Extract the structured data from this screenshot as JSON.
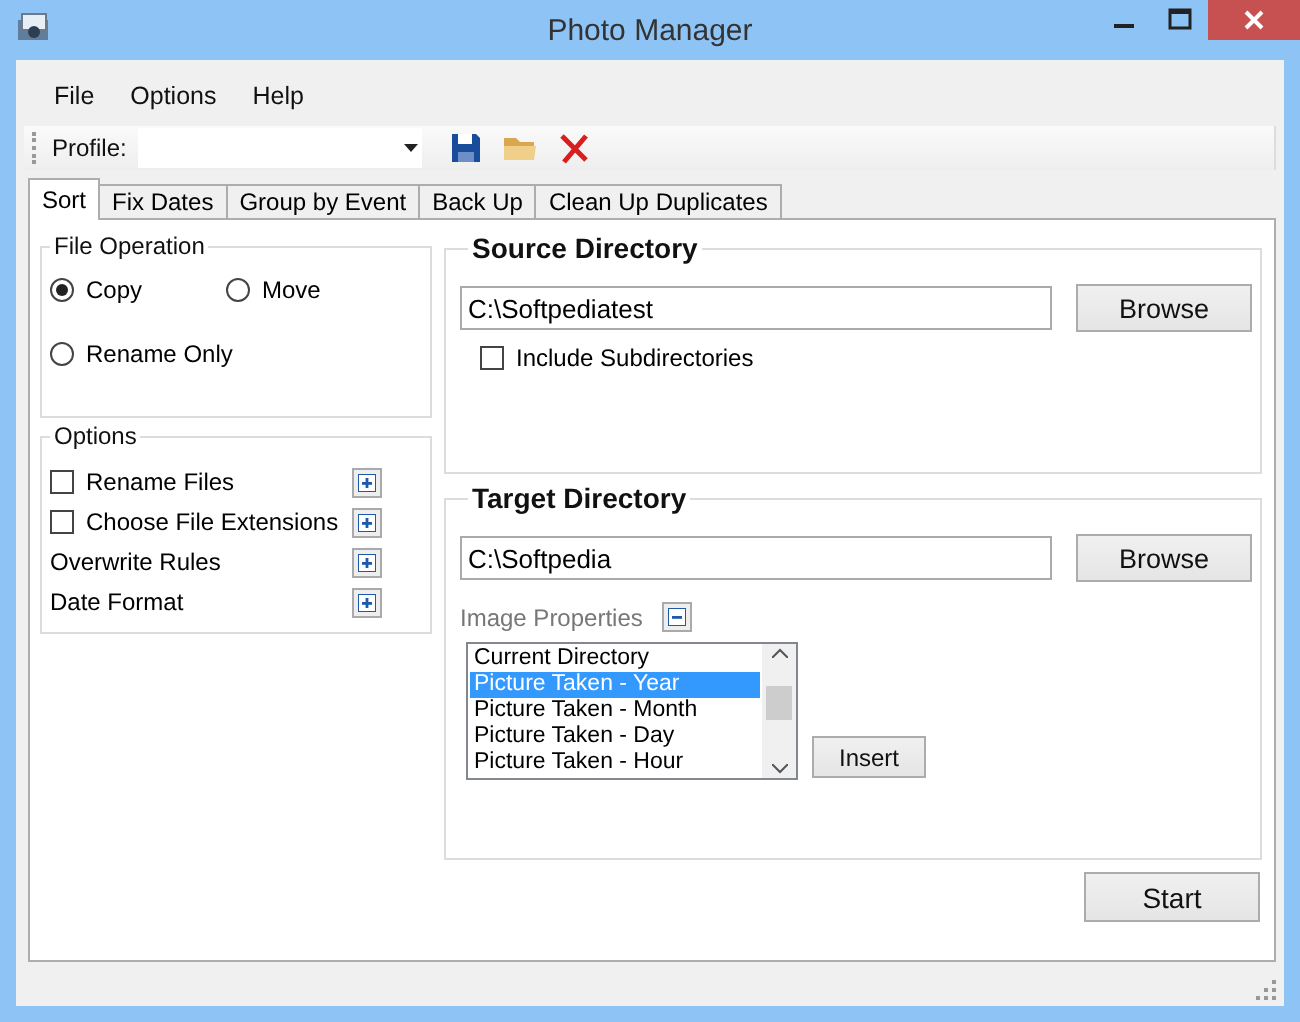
{
  "window": {
    "title": "Photo Manager"
  },
  "menu": [
    "File",
    "Options",
    "Help"
  ],
  "toolbar": {
    "profile_label": "Profile:"
  },
  "tabs": [
    {
      "label": "Sort",
      "selected": true
    },
    {
      "label": "Fix Dates",
      "selected": false
    },
    {
      "label": "Group by Event",
      "selected": false
    },
    {
      "label": "Back Up",
      "selected": false
    },
    {
      "label": "Clean Up Duplicates",
      "selected": false
    }
  ],
  "file_operation": {
    "title": "File Operation",
    "choices": [
      {
        "label": "Copy",
        "selected": true
      },
      {
        "label": "Move",
        "selected": false
      },
      {
        "label": "Rename Only",
        "selected": false
      }
    ]
  },
  "options": {
    "title": "Options",
    "items": [
      {
        "kind": "checkbox",
        "label": "Rename Files",
        "checked": false,
        "expanded": false
      },
      {
        "kind": "checkbox",
        "label": "Choose File Extensions",
        "checked": false,
        "expanded": false
      },
      {
        "kind": "plain",
        "label": "Overwrite Rules",
        "expanded": false
      },
      {
        "kind": "plain",
        "label": "Date Format",
        "expanded": false
      }
    ]
  },
  "source": {
    "title": "Source Directory",
    "path": "C:\\Softpediatest",
    "browse": "Browse",
    "include_subdirectories": {
      "label": "Include Subdirectories",
      "checked": false
    }
  },
  "target": {
    "title": "Target Directory",
    "path": "C:\\Softpedia",
    "browse": "Browse",
    "image_properties": {
      "label": "Image Properties",
      "expanded": true,
      "items": [
        {
          "label": "Current Directory",
          "selected": false
        },
        {
          "label": "Picture Taken - Year",
          "selected": true
        },
        {
          "label": "Picture Taken - Month",
          "selected": false
        },
        {
          "label": "Picture Taken - Day",
          "selected": false
        },
        {
          "label": "Picture Taken - Hour",
          "selected": false
        }
      ],
      "insert": "Insert"
    }
  },
  "start": "Start"
}
